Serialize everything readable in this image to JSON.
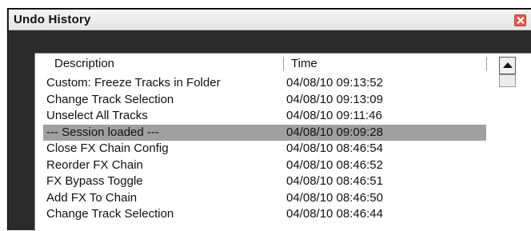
{
  "window": {
    "title": "Undo History"
  },
  "columns": {
    "description": "Description",
    "time": "Time"
  },
  "rows": [
    {
      "description": "Custom: Freeze Tracks in Folder",
      "time": "04/08/10 09:13:52"
    },
    {
      "description": "Change Track Selection",
      "time": "04/08/10 09:13:09"
    },
    {
      "description": "Unselect All Tracks",
      "time": "04/08/10 09:11:46"
    },
    {
      "description": "--- Session loaded ---",
      "time": "04/08/10 09:09:28"
    },
    {
      "description": "Close FX Chain Config",
      "time": "04/08/10 08:46:54"
    },
    {
      "description": "Reorder FX Chain",
      "time": "04/08/10 08:46:52"
    },
    {
      "description": "FX Bypass Toggle",
      "time": "04/08/10 08:46:51"
    },
    {
      "description": "Add FX To Chain",
      "time": "04/08/10 08:46:50"
    },
    {
      "description": "Change Track Selection",
      "time": "04/08/10 08:46:44"
    }
  ],
  "selected_row": 3,
  "icons": {
    "close": "close-icon",
    "scroll_up": "scroll-up-arrow-icon"
  },
  "colors": {
    "selection": "#a0a0a0",
    "frame": "#2b2b2b",
    "close_button": "#e05c50"
  }
}
